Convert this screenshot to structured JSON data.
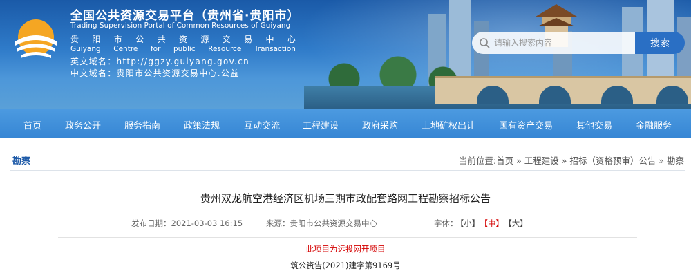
{
  "header": {
    "site_title": "全国公共资源交易平台（贵州省·贵阳市）",
    "site_subtitle": "Trading Supervision Portal of Common Resources of Guiyang",
    "centre_cn_chars": [
      "贵",
      "阳",
      "市",
      "公",
      "共",
      "资",
      "源",
      "交",
      "易",
      "中",
      "心"
    ],
    "centre_en_words": [
      "Guiyang",
      "Centre",
      "for",
      "public",
      "Resource",
      "Transaction"
    ],
    "domain_en": "英文域名：http://ggzy.guiyang.gov.cn",
    "domain_cn": "中文域名：贵阳市公共资源交易中心.公益",
    "logo_icon": "sunrise-logo-icon"
  },
  "search": {
    "placeholder": "请输入搜索内容",
    "button_label": "搜索",
    "icon": "search-icon"
  },
  "nav": {
    "items": [
      "首页",
      "政务公开",
      "服务指南",
      "政策法规",
      "互动交流",
      "工程建设",
      "政府采购",
      "土地矿权出让",
      "国有资产交易",
      "其他交易",
      "金融服务"
    ]
  },
  "section": {
    "title": "勘察",
    "breadcrumb_prefix": "当前位置:",
    "breadcrumb": [
      "首页",
      "工程建设",
      "招标（资格预审）公告",
      "勘察"
    ],
    "separator": " » "
  },
  "article": {
    "title": "贵州双龙航空港经济区机场三期市政配套路网工程勘察招标公告",
    "publish_label": "发布日期：",
    "publish_date": "2021-03-03 16:15",
    "source_label": "来源：",
    "source": "贵阳市公共资源交易中心",
    "font_label": "字体：",
    "font_sizes": [
      "【小】",
      "【中】",
      "【大】"
    ],
    "font_size_selected": "【中】",
    "notice": "此项目为远投网开项目",
    "doc_number": "筑公资告(2021)建字第9169号"
  },
  "colors": {
    "nav_bg": "#3686d4",
    "section_title": "#1f5ba8",
    "highlight_red": "#d40000",
    "search_button": "#2a6fc4"
  }
}
